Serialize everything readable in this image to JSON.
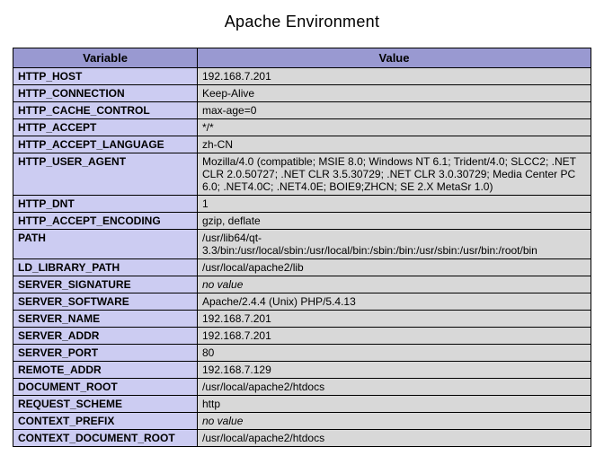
{
  "title": "Apache Environment",
  "headers": {
    "variable": "Variable",
    "value": "Value"
  },
  "no_value_text": "no value",
  "rows": [
    {
      "variable": "HTTP_HOST",
      "value": "192.168.7.201"
    },
    {
      "variable": "HTTP_CONNECTION",
      "value": "Keep-Alive"
    },
    {
      "variable": "HTTP_CACHE_CONTROL",
      "value": "max-age=0"
    },
    {
      "variable": "HTTP_ACCEPT",
      "value": "*/*"
    },
    {
      "variable": "HTTP_ACCEPT_LANGUAGE",
      "value": "zh-CN"
    },
    {
      "variable": "HTTP_USER_AGENT",
      "value": "Mozilla/4.0 (compatible; MSIE 8.0; Windows NT 6.1; Trident/4.0; SLCC2; .NET CLR 2.0.50727; .NET CLR 3.5.30729; .NET CLR 3.0.30729; Media Center PC 6.0; .NET4.0C; .NET4.0E; BOIE9;ZHCN; SE 2.X MetaSr 1.0)"
    },
    {
      "variable": "HTTP_DNT",
      "value": "1"
    },
    {
      "variable": "HTTP_ACCEPT_ENCODING",
      "value": "gzip, deflate"
    },
    {
      "variable": "PATH",
      "value": "/usr/lib64/qt-3.3/bin:/usr/local/sbin:/usr/local/bin:/sbin:/bin:/usr/sbin:/usr/bin:/root/bin"
    },
    {
      "variable": "LD_LIBRARY_PATH",
      "value": "/usr/local/apache2/lib"
    },
    {
      "variable": "SERVER_SIGNATURE",
      "value": null
    },
    {
      "variable": "SERVER_SOFTWARE",
      "value": "Apache/2.4.4 (Unix) PHP/5.4.13"
    },
    {
      "variable": "SERVER_NAME",
      "value": "192.168.7.201"
    },
    {
      "variable": "SERVER_ADDR",
      "value": "192.168.7.201"
    },
    {
      "variable": "SERVER_PORT",
      "value": "80"
    },
    {
      "variable": "REMOTE_ADDR",
      "value": "192.168.7.129"
    },
    {
      "variable": "DOCUMENT_ROOT",
      "value": "/usr/local/apache2/htdocs"
    },
    {
      "variable": "REQUEST_SCHEME",
      "value": "http"
    },
    {
      "variable": "CONTEXT_PREFIX",
      "value": null
    },
    {
      "variable": "CONTEXT_DOCUMENT_ROOT",
      "value": "/usr/local/apache2/htdocs"
    }
  ]
}
